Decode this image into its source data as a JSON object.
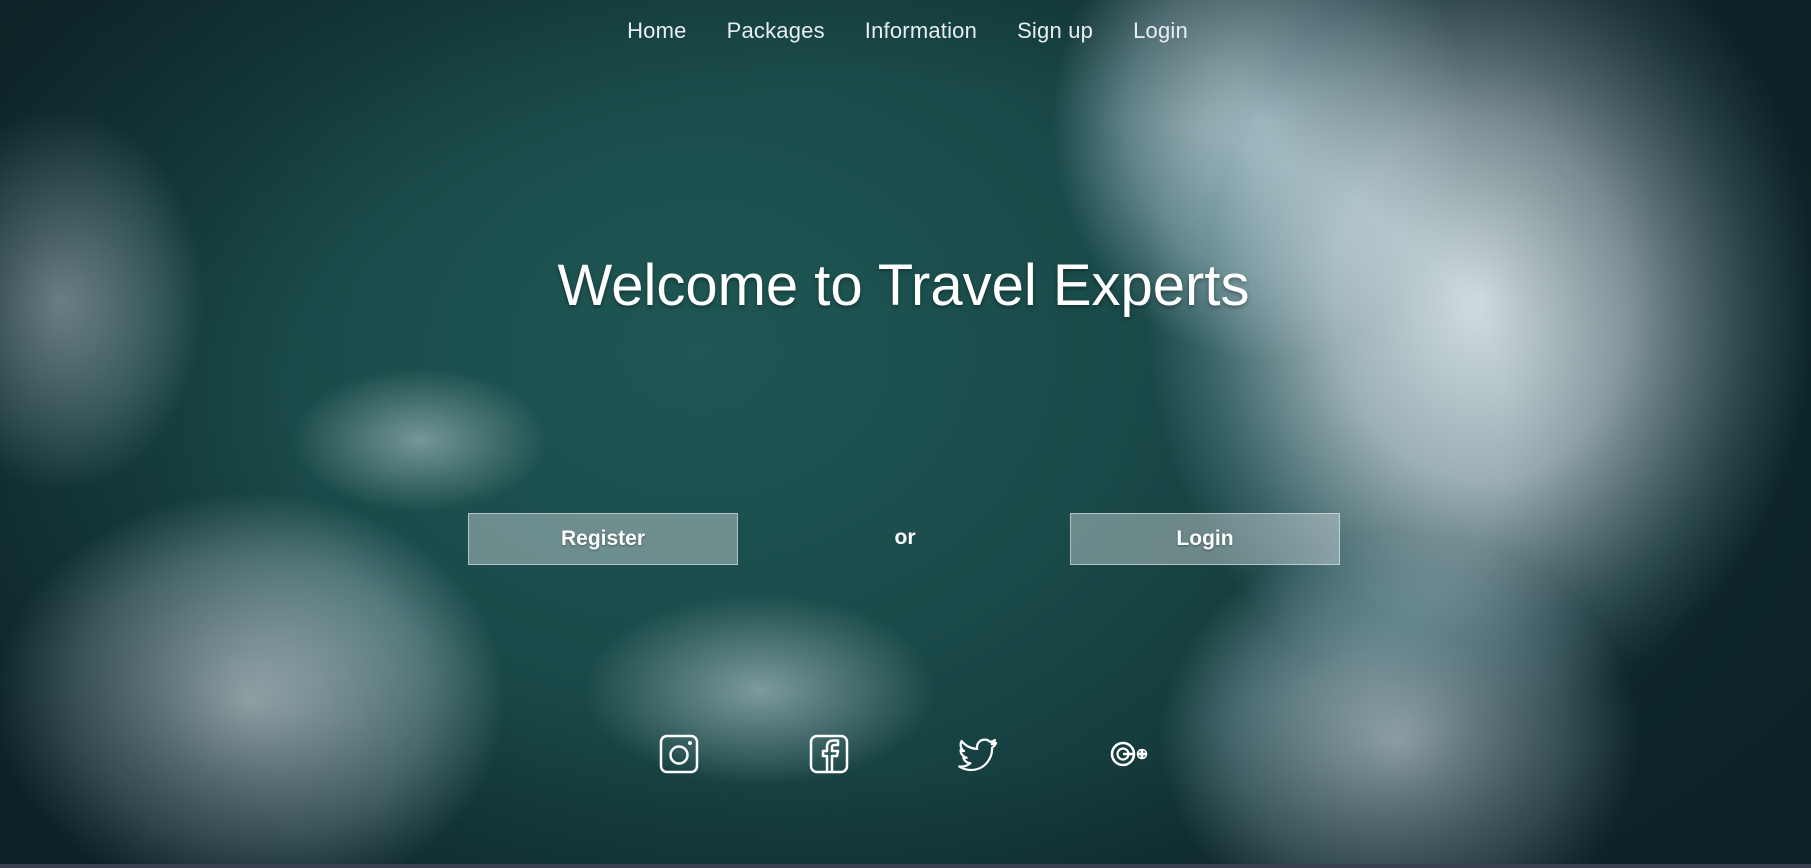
{
  "nav": {
    "items": [
      {
        "label": "Home"
      },
      {
        "label": "Packages"
      },
      {
        "label": "Information"
      },
      {
        "label": "Sign up"
      },
      {
        "label": "Login"
      }
    ]
  },
  "hero": {
    "title": "Welcome to Travel Experts"
  },
  "cta": {
    "register_label": "Register",
    "or_label": "or",
    "login_label": "Login"
  },
  "social": {
    "icons": [
      "instagram-icon",
      "facebook-icon",
      "twitter-icon",
      "google-plus-icon"
    ]
  },
  "colors": {
    "text": "#ffffff",
    "nav_text": "#e8eef0",
    "button_bg": "rgba(210,220,222,0.45)",
    "ocean": "#1b4a49"
  }
}
